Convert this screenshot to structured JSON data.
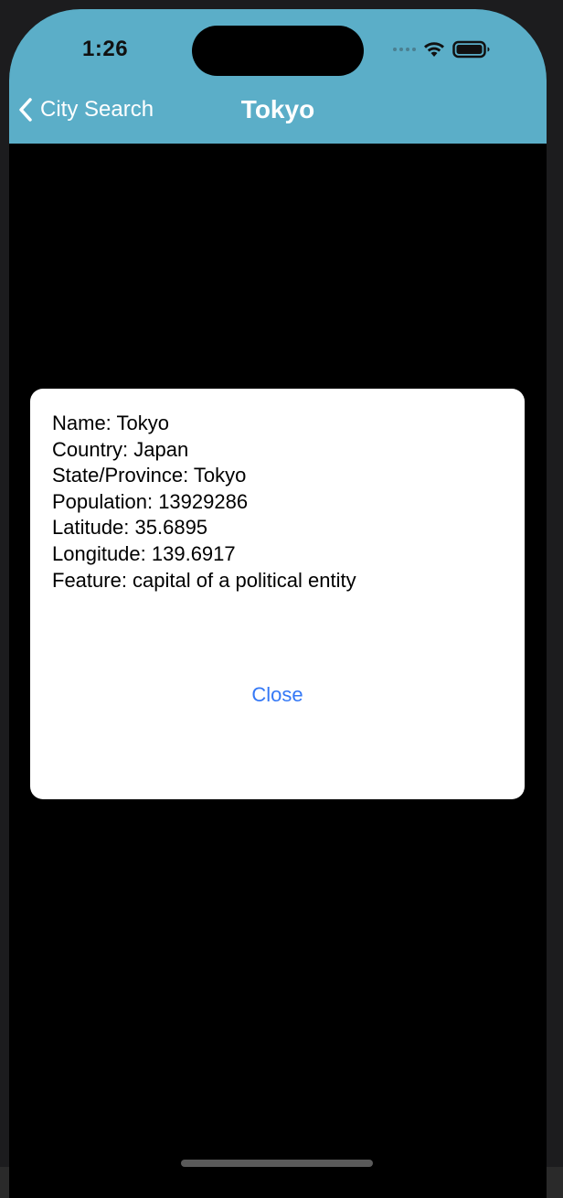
{
  "status_bar": {
    "time": "1:26",
    "wifi_icon": "wifi-icon",
    "battery_icon": "battery-icon"
  },
  "navbar": {
    "back_label": "City Search",
    "title": "Tokyo",
    "color": "#5baec8"
  },
  "dialog": {
    "lines": [
      "Name: Tokyo",
      "Country: Japan",
      "State/Province: Tokyo",
      "Population: 13929286",
      "Latitude: 35.6895",
      "Longitude: 139.6917",
      "Feature: capital of a political entity"
    ],
    "close_label": "Close",
    "close_color": "#3478f6"
  }
}
